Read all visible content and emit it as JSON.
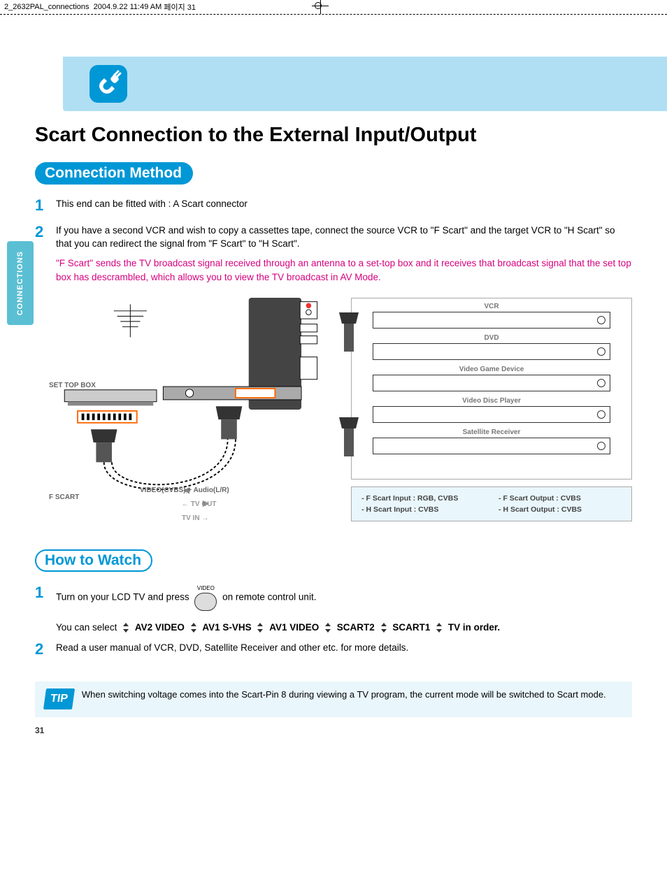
{
  "crop": {
    "filename": "2_2632PAL_connections",
    "timestamp": "2004.9.22 11:49 AM",
    "page_tag": "페이지 31"
  },
  "sideTab": "CONNECTIONS",
  "title": "Scart Connection to the External Input/Output",
  "section1": {
    "heading": "Connection Method",
    "step1": "This end can be fitted with : A Scart connector",
    "step2a": "If you have a second VCR and wish to copy a cassettes tape, connect the source VCR to \"F Scart\" and the target VCR to \"H Scart\" so that you can redirect the signal from \"F Scart\" to \"H Scart\".",
    "step2b": "\"F Scart\" sends the TV broadcast signal received through an antenna to a set-top box and it receives that broadcast signal that the set top box has descrambled, which allows you to view the TV broadcast in AV Mode."
  },
  "diagram": {
    "setTopBox": "SET TOP BOX",
    "fScart": "F SCART",
    "videoLabel": "VIDEO(CVBS) + Audio(L/R)",
    "tvOut": "TV OUT",
    "tvIn": "TV IN",
    "tvOutArrow": "←",
    "tvInArrow": "→",
    "devices": [
      "VCR",
      "DVD",
      "Video Game Device",
      "Video Disc Player",
      "Satellite Receiver"
    ],
    "spec": {
      "fIn": "- F Scart Input : RGB, CVBS",
      "fOut": "- F Scart Output : CVBS",
      "hIn": "- H Scart Input : CVBS",
      "hOut": "- H Scart Output : CVBS"
    }
  },
  "section2": {
    "heading": "How to Watch",
    "remoteBtn": "VIDEO",
    "step1a": "Turn on your LCD TV and press",
    "step1b": "on remote control unit.",
    "select_intro": "You can select",
    "select_items": [
      "AV2 VIDEO",
      "AV1 S-VHS",
      "AV1 VIDEO",
      "SCART2",
      "SCART1",
      "TV in order."
    ],
    "step2": "Read a user manual of VCR, DVD, Satellite Receiver and other etc. for more details."
  },
  "tip": {
    "badge": "TIP",
    "text": "When switching voltage comes into the Scart-Pin 8 during viewing a TV program, the current mode will be switched to Scart mode."
  },
  "pageNumber": "31"
}
